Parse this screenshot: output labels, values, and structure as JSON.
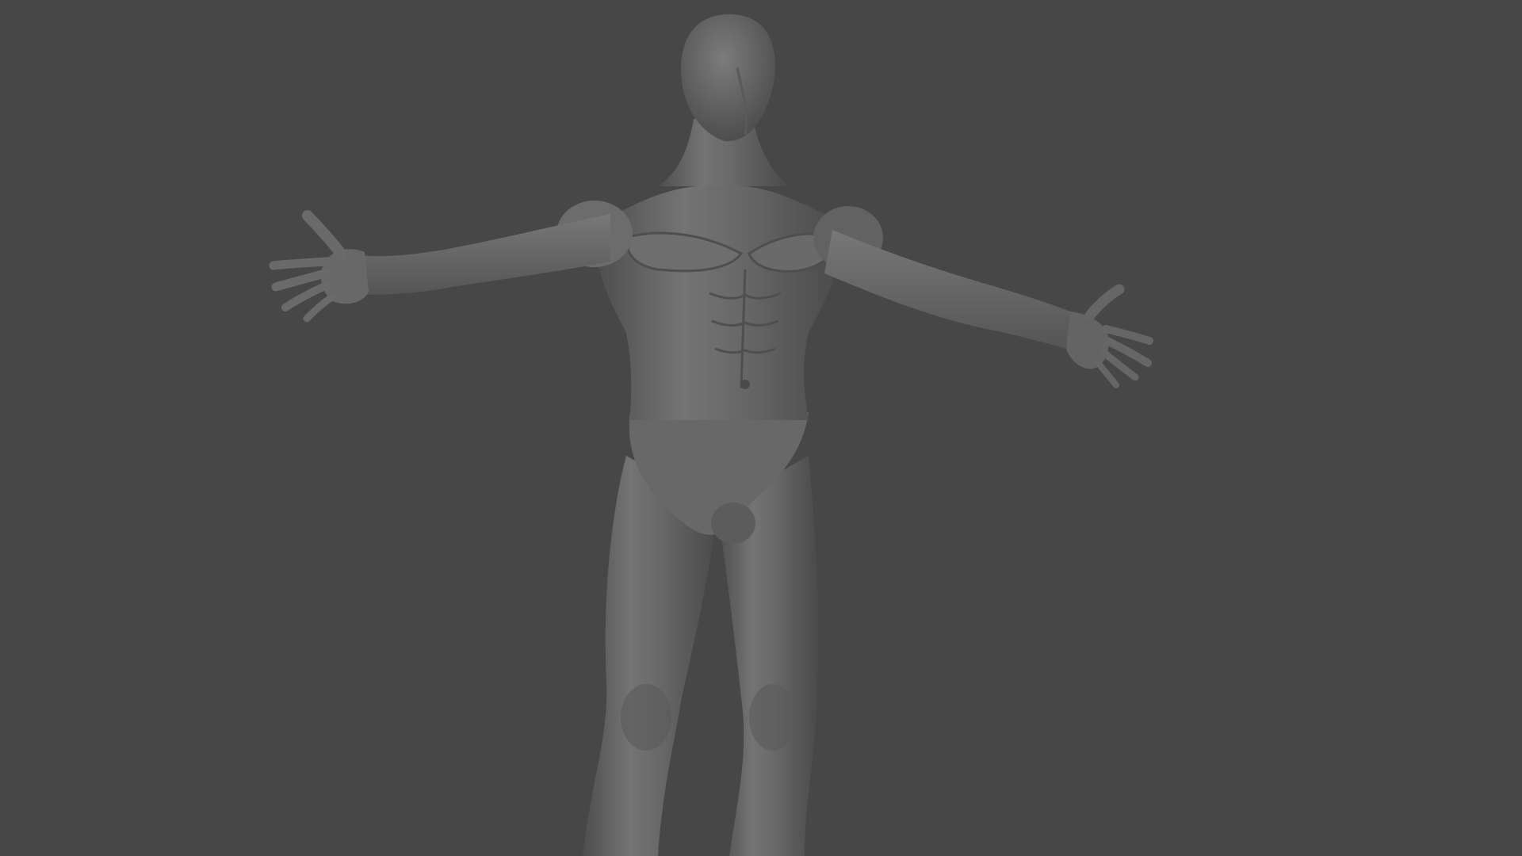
{
  "viewport": {
    "background_color": "#474747",
    "mesh_base_color": "#6c6c6c",
    "mesh_shadow_color": "#3e3e3e",
    "mesh_highlight_color": "#8a8a8a",
    "subject": "sculpted-human-base-mesh",
    "pose": "arms-outstretched",
    "shading": "solid-matcap-grey"
  }
}
